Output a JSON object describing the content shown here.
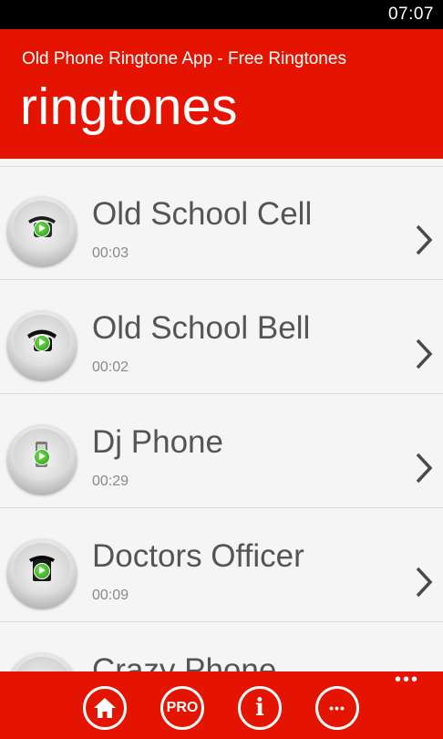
{
  "status_bar": {
    "time": "07:07"
  },
  "header": {
    "app_title": "Old Phone Ringtone App - Free Ringtones",
    "page_title": "ringtones"
  },
  "ringtones": [
    {
      "title": "Old School Cell",
      "duration": "00:03",
      "icon": "phone-icon"
    },
    {
      "title": "Old School Bell",
      "duration": "00:02",
      "icon": "phone-icon"
    },
    {
      "title": "Dj Phone",
      "duration": "00:29",
      "icon": "phone-icon"
    },
    {
      "title": "Doctors Officer",
      "duration": "00:09",
      "icon": "phone-icon"
    },
    {
      "title": "Crazy Phone",
      "duration": "",
      "icon": "phone-icon"
    }
  ],
  "app_bar": {
    "more_glyph": "•••",
    "buttons": [
      {
        "icon": "home-icon",
        "label": ""
      },
      {
        "icon": "pro-icon",
        "label": "PRO"
      },
      {
        "icon": "info-icon",
        "label": "i"
      },
      {
        "icon": "more-icon",
        "label": "•••"
      }
    ]
  },
  "colors": {
    "accent": "#e51400",
    "background": "#f5f5f5",
    "title_text": "#555555",
    "secondary_text": "#8a8a8a"
  }
}
